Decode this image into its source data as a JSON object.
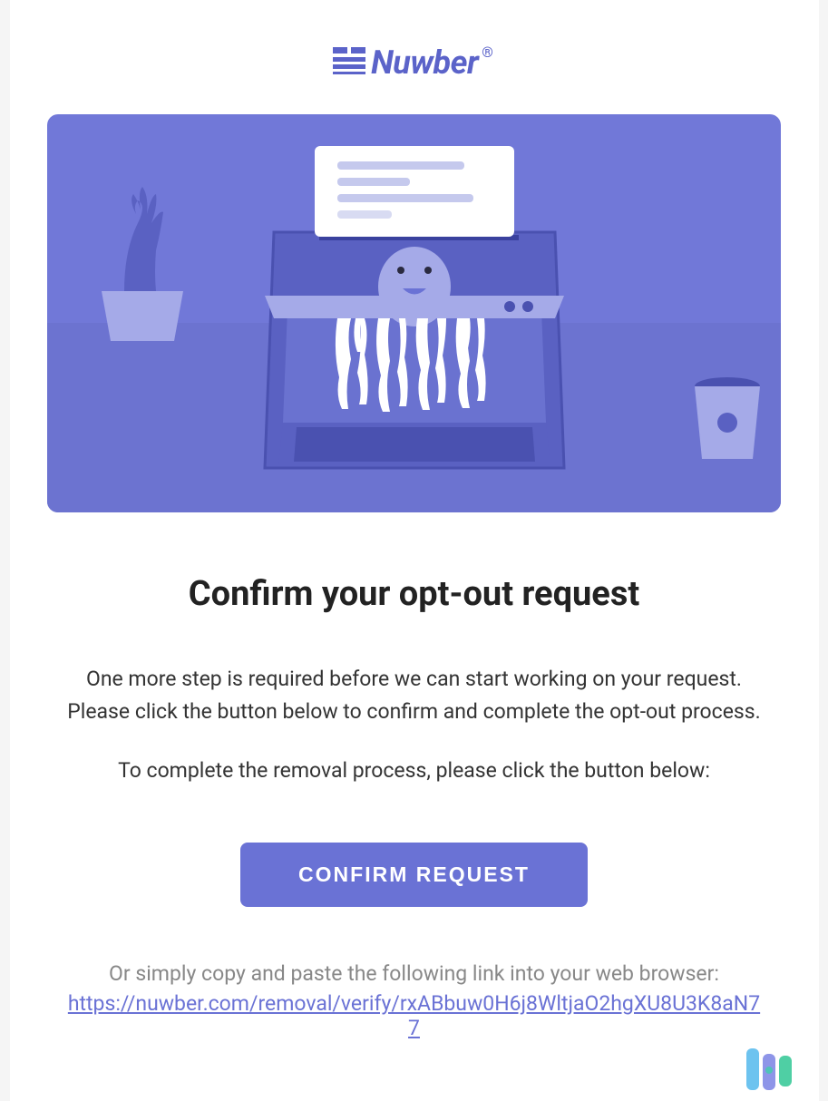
{
  "brand": {
    "name": "Nuwber",
    "registered_mark": "®"
  },
  "heading": "Confirm your opt-out request",
  "body_paragraph_1": "One more step is required before we can start working on your request. Please click the button below to confirm and complete the opt-out process.",
  "body_paragraph_2": "To complete the removal process, please click the button below:",
  "button_label": "CONFIRM REQUEST",
  "alt_instruction": "Or simply copy and paste the following link into your web browser:",
  "verify_url": "https://nuwber.com/removal/verify/rxABbuw0H6j8WltjaO2hgXU8U3K8aN77"
}
